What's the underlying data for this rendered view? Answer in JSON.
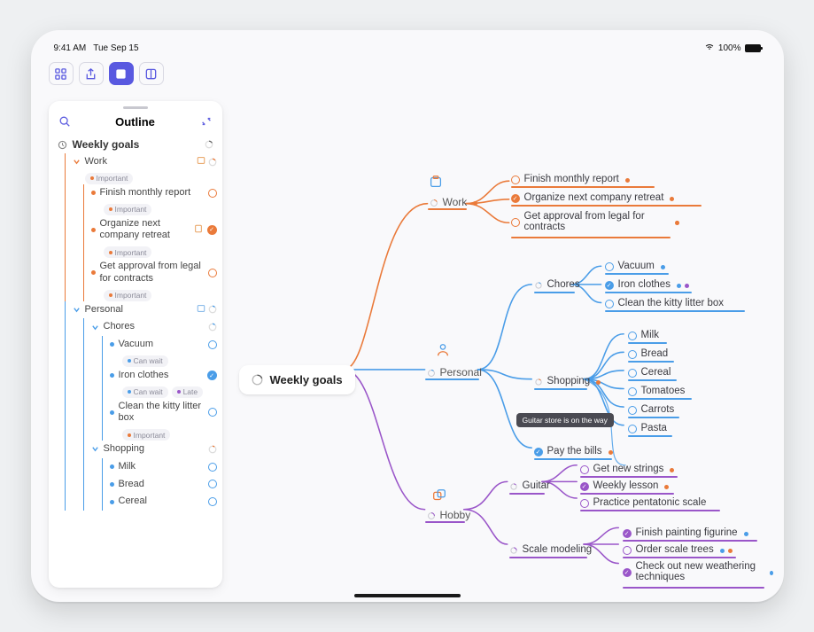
{
  "status": {
    "time": "9:41 AM",
    "date": "Tue Sep 15",
    "battery": "100%"
  },
  "sidebar": {
    "title": "Outline",
    "root": "Weekly goals",
    "work": {
      "label": "Work",
      "important": "Important",
      "items": [
        {
          "label": "Finish monthly report",
          "tag": "Important"
        },
        {
          "label": "Organize next company retreat",
          "tag": "Important"
        },
        {
          "label": "Get approval from legal for contracts",
          "tag": "Important"
        }
      ]
    },
    "personal": {
      "label": "Personal",
      "chores": {
        "label": "Chores",
        "items": [
          {
            "label": "Vacuum",
            "tag": "Can wait"
          },
          {
            "label": "Iron clothes",
            "tag": "Can wait",
            "tag2": "Late"
          },
          {
            "label": "Clean the kitty litter box",
            "tag": "Important"
          }
        ]
      },
      "shopping": {
        "label": "Shopping",
        "items": [
          {
            "label": "Milk"
          },
          {
            "label": "Bread"
          },
          {
            "label": "Cereal"
          }
        ]
      }
    }
  },
  "map": {
    "root": "Weekly goals",
    "work": {
      "label": "Work",
      "items": [
        "Finish monthly report",
        "Organize next company retreat",
        "Get approval from legal for contracts"
      ]
    },
    "personal": {
      "label": "Personal",
      "chores": {
        "label": "Chores",
        "items": [
          "Vacuum",
          "Iron clothes",
          "Clean the kitty litter box"
        ]
      },
      "shopping": {
        "label": "Shopping",
        "items": [
          "Milk",
          "Bread",
          "Cereal",
          "Tomatoes",
          "Carrots",
          "Pasta"
        ]
      },
      "bills": "Pay the bills"
    },
    "hobby": {
      "label": "Hobby",
      "guitar": {
        "label": "Guitar",
        "items": [
          "Get new strings",
          "Weekly lesson",
          "Practice pentatonic scale"
        ]
      },
      "scale": {
        "label": "Scale modeling",
        "items": [
          "Finish painting figurine",
          "Order scale trees",
          "Check out new weathering techniques"
        ]
      }
    },
    "tooltip": "Guitar store is on the way"
  },
  "colors": {
    "orange": "#ea7a3a",
    "blue": "#4a9de8",
    "purple": "#9a56c9"
  }
}
